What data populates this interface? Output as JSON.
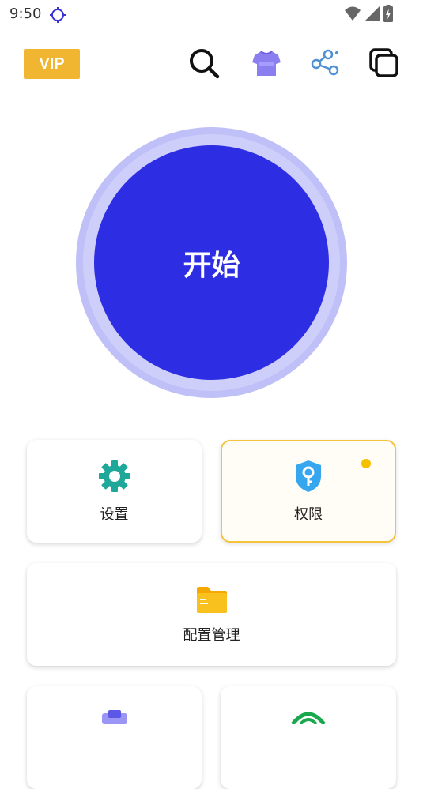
{
  "status_bar": {
    "time": "9:50",
    "icons": [
      "location-icon",
      "wifi-icon",
      "signal-icon",
      "battery-charging-icon"
    ]
  },
  "header": {
    "vip_label": "VIP",
    "icons": [
      "search-icon",
      "tshirt-icon",
      "share-icon",
      "copy-windows-icon"
    ]
  },
  "main": {
    "start_label": "开始"
  },
  "cards": {
    "settings": {
      "label": "设置",
      "icon": "gear-icon"
    },
    "permissions": {
      "label": "权限",
      "icon": "shield-key-icon"
    },
    "config": {
      "label": "配置管理",
      "icon": "folder-icon"
    }
  },
  "colors": {
    "vip": "#f0b631",
    "start_button": "#2d2de3",
    "start_halo": "#bfc0f7",
    "settings_icon": "#1fa89a",
    "permissions_icon": "#36a6ef",
    "folder_icon": "#f9c11e",
    "highlight_border": "#f5c33b"
  }
}
